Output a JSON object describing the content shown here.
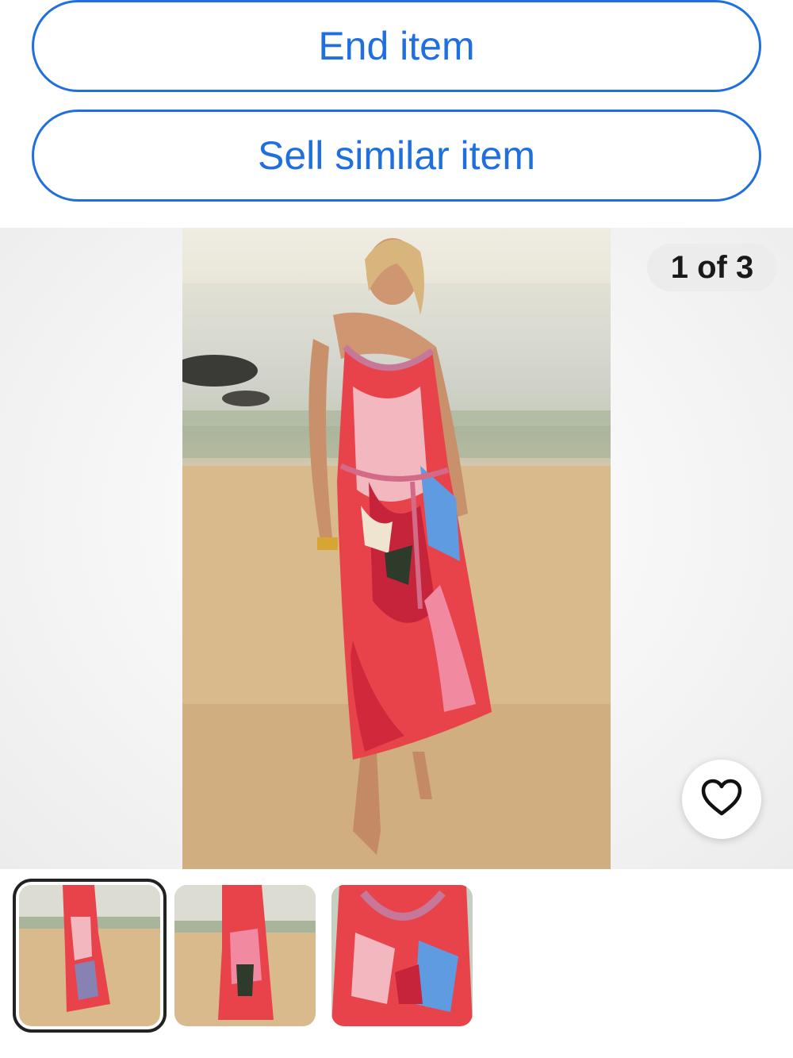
{
  "actions": {
    "end_item_label": "End item",
    "sell_similar_label": "Sell similar item"
  },
  "gallery": {
    "counter": "1 of 3",
    "current_index": 1,
    "total": 3,
    "favorite_icon": "heart-outline-icon",
    "thumbnails": [
      {
        "selected": true
      },
      {
        "selected": false
      },
      {
        "selected": false
      }
    ]
  },
  "colors": {
    "accent_blue": "#1f6fe0",
    "counter_bg": "#ececec",
    "selected_outline": "#222222"
  }
}
